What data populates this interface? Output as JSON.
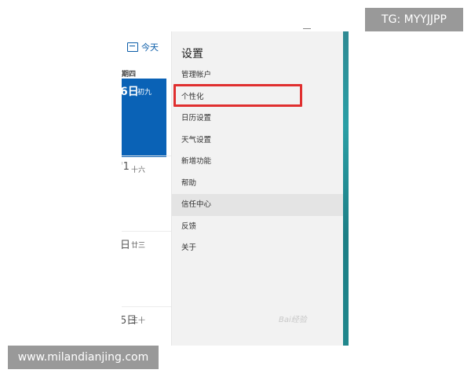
{
  "calendar": {
    "today_label": "今天",
    "weekday": "期四",
    "selected_day": {
      "number": "6日",
      "lunar": "初九"
    },
    "days": [
      {
        "number": "'1",
        "lunar": "十六"
      },
      {
        "number": "日",
        "lunar": "廿三"
      },
      {
        "number": "5日",
        "lunar": "三十"
      }
    ]
  },
  "settings": {
    "title": "设置",
    "items": [
      "管理帐户",
      "个性化",
      "日历设置",
      "天气设置",
      "新增功能",
      "帮助",
      "信任中心",
      "反馈",
      "关于"
    ],
    "highlighted_item": "个性化",
    "hovered_item": "信任中心"
  },
  "overlays": {
    "tag": "TG: MYYJJPP",
    "site": "www.milandianjing.com",
    "logo": "Bai经验"
  },
  "colors": {
    "accent_blue": "#0a62b6",
    "highlight_red": "#e02f2f",
    "panel_bg": "#f2f2f2",
    "teal_strip": "#2a9fa5",
    "badge_gray": "#999999"
  }
}
